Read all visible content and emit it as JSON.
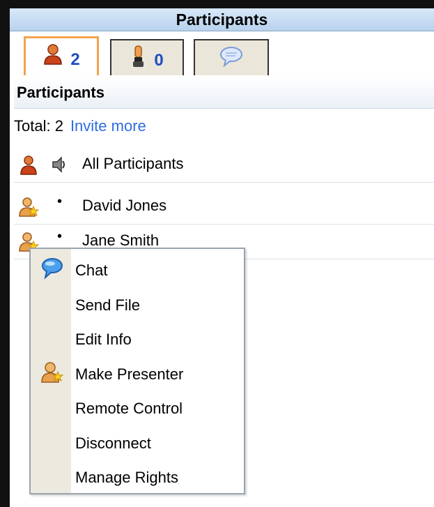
{
  "window": {
    "title": "Participants"
  },
  "tabs": [
    {
      "icon": "participant-icon",
      "count": "2"
    },
    {
      "icon": "raised-hand-icon",
      "count": "0"
    },
    {
      "icon": "chat-bubble-icon"
    }
  ],
  "section": {
    "title": "Participants"
  },
  "summary": {
    "total_label": "Total: 2",
    "invite_label": "Invite more"
  },
  "participants": [
    {
      "name": "All Participants",
      "icon": "participant-group-icon",
      "status_icon": "speaker-icon"
    },
    {
      "name": "David Jones",
      "icon": "presenter-icon",
      "status": "•"
    },
    {
      "name": "Jane Smith",
      "icon": "presenter-icon",
      "status": "•"
    }
  ],
  "context_menu": {
    "items": [
      {
        "label": "Chat",
        "icon": "chat-bubble-icon"
      },
      {
        "label": "Send File"
      },
      {
        "label": "Edit Info"
      },
      {
        "label": "Make Presenter",
        "icon": "presenter-icon"
      },
      {
        "label": "Remote Control"
      },
      {
        "label": "Disconnect"
      },
      {
        "label": "Manage Rights"
      }
    ]
  },
  "colors": {
    "title_bar": "#c8dcf2",
    "link": "#2d6de0",
    "count": "#1c4fc4",
    "active_tab_border": "#f2a34b"
  }
}
